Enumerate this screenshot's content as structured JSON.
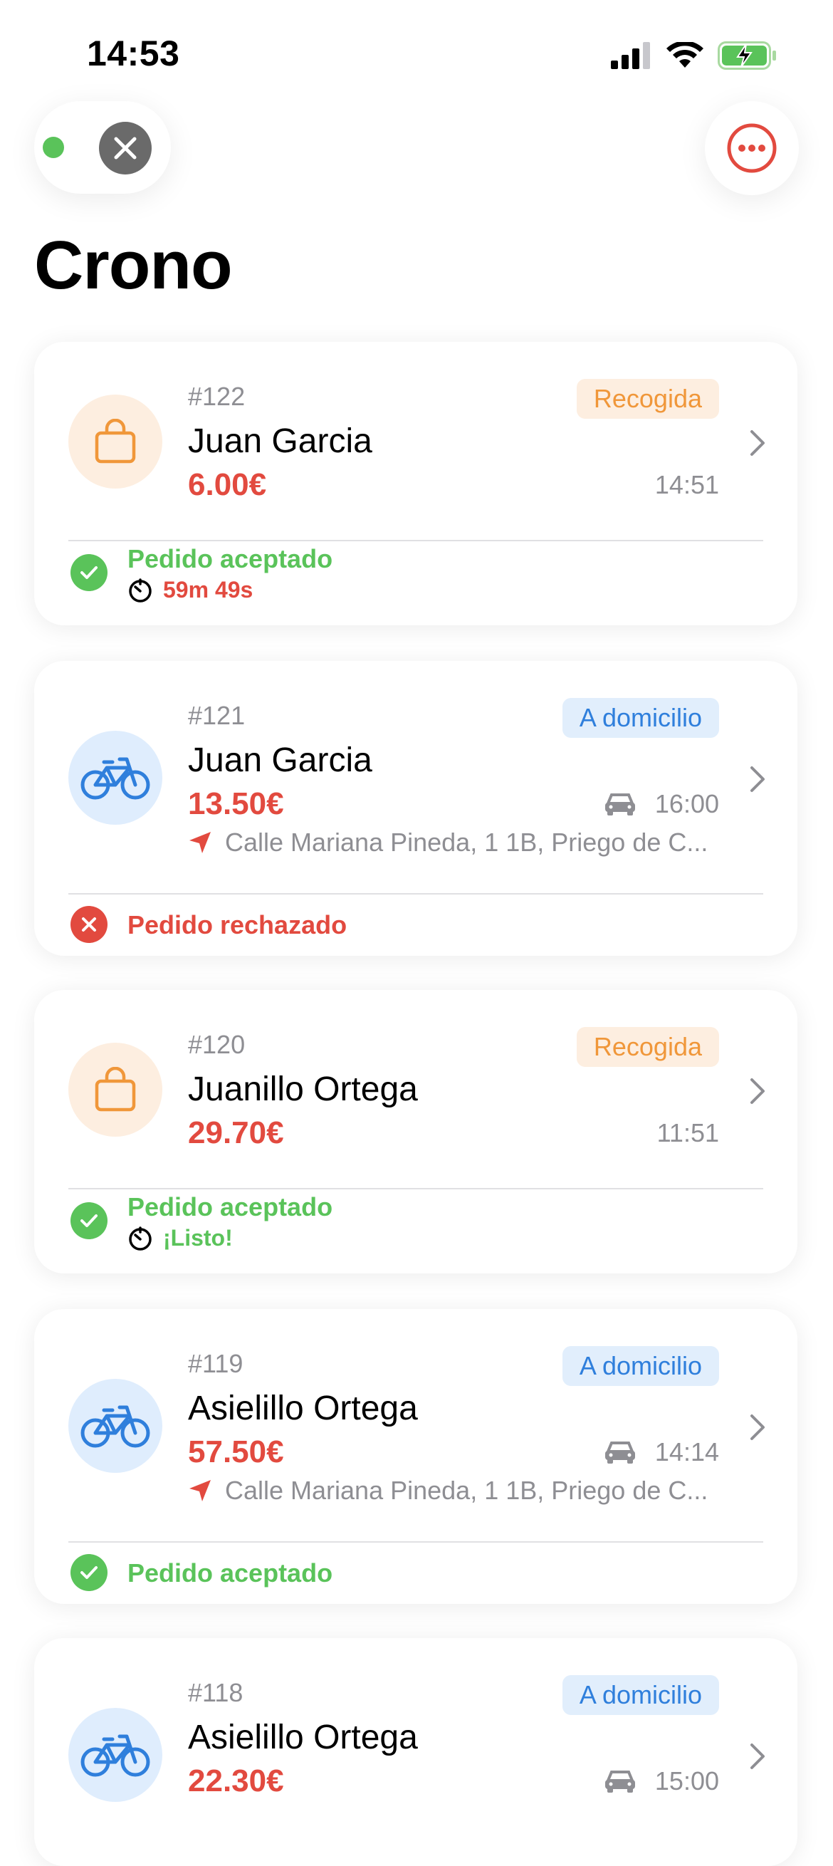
{
  "status_bar": {
    "time": "14:53"
  },
  "header": {
    "title": "Crono"
  },
  "colors": {
    "accent_red": "#e24a3f",
    "green": "#5ac35a",
    "orange": "#f0973a",
    "blue": "#2f7fdc"
  },
  "orders": [
    {
      "number": "#122",
      "type_label": "Recogida",
      "customer": "Juan Garcia",
      "price": "6.00€",
      "time": "14:51",
      "status": "Pedido aceptado",
      "timer": "59m 49s"
    },
    {
      "number": "#121",
      "type_label": "A domicilio",
      "customer": "Juan Garcia",
      "price": "13.50€",
      "time": "16:00",
      "address": "Calle Mariana Pineda, 1 1B, Priego de C...",
      "status": "Pedido rechazado"
    },
    {
      "number": "#120",
      "type_label": "Recogida",
      "customer": "Juanillo Ortega",
      "price": "29.70€",
      "time": "11:51",
      "status": "Pedido aceptado",
      "timer": "¡Listo!"
    },
    {
      "number": "#119",
      "type_label": "A domicilio",
      "customer": "Asielillo Ortega",
      "price": "57.50€",
      "time": "14:14",
      "address": "Calle Mariana Pineda, 1 1B, Priego de C...",
      "status": "Pedido aceptado"
    },
    {
      "number": "#118",
      "type_label": "A domicilio",
      "customer": "Asielillo Ortega",
      "price": "22.30€",
      "time": "15:00"
    }
  ]
}
